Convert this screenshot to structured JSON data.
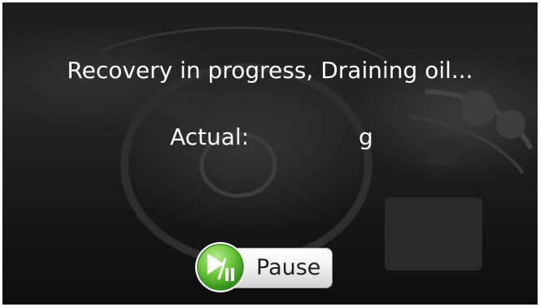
{
  "status": {
    "message": "Recovery in progress, Draining oil..."
  },
  "reading": {
    "label": "Actual:",
    "value": "",
    "unit": "g"
  },
  "controls": {
    "pause_label": "Pause",
    "pause_icon": "play-pause-icon"
  },
  "colors": {
    "text": "#ffffff",
    "button_green": "#6cc63a",
    "button_face": "#f2f2f2"
  }
}
